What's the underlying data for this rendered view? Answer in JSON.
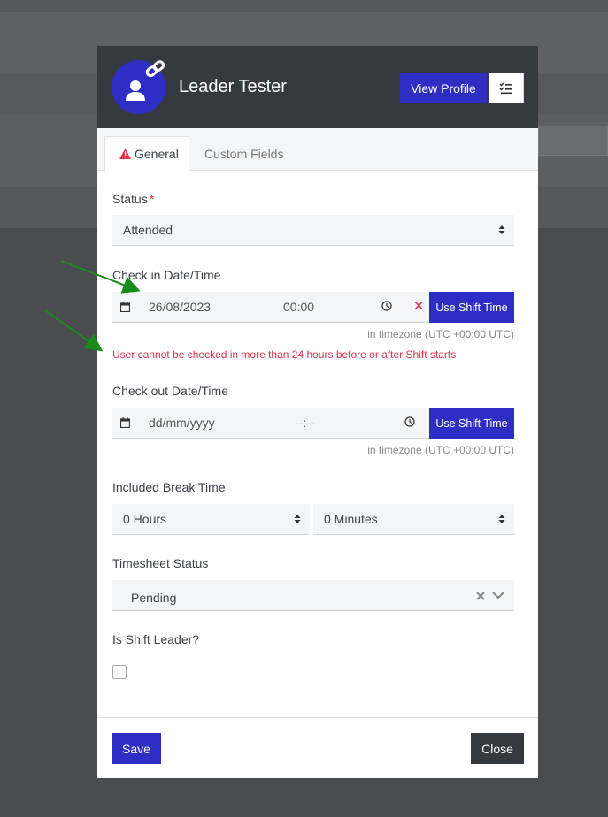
{
  "header": {
    "name": "Leader Tester",
    "view_profile_label": "View Profile",
    "avatar_icon": "user-link-icon",
    "list_icon": "checklist-icon"
  },
  "tabs": [
    {
      "label": "General",
      "icon": "warning-icon",
      "active": true
    },
    {
      "label": "Custom Fields",
      "active": false
    }
  ],
  "form": {
    "status": {
      "label": "Status",
      "value": "Attended",
      "required": "*"
    },
    "check_in": {
      "label": "Check in Date/Time",
      "date": "26/08/2023",
      "time": "00:00",
      "button": "Use Shift Time",
      "timezone": "in timezone (UTC +00:00 UTC)",
      "error": "User cannot be checked in more than 24 hours before or after Shift starts"
    },
    "check_out": {
      "label": "Check out Date/Time",
      "date_placeholder": "dd/mm/yyyy",
      "time_placeholder": "--:--",
      "button": "Use Shift Time",
      "timezone": "in timezone (UTC +00:00 UTC)"
    },
    "break_time": {
      "label": "Included Break Time",
      "hours": "0 Hours",
      "minutes": "0 Minutes"
    },
    "timesheet_status": {
      "label": "Timesheet Status",
      "value": "Pending"
    },
    "is_shift_leader": {
      "label": "Is Shift Leader?",
      "checked": false
    }
  },
  "footer": {
    "save_label": "Save",
    "close_label": "Close"
  },
  "colors": {
    "primary": "#2f2ec4",
    "header_bg": "#353a41",
    "error": "#e0314b",
    "annotation": "#1a8a1a"
  }
}
